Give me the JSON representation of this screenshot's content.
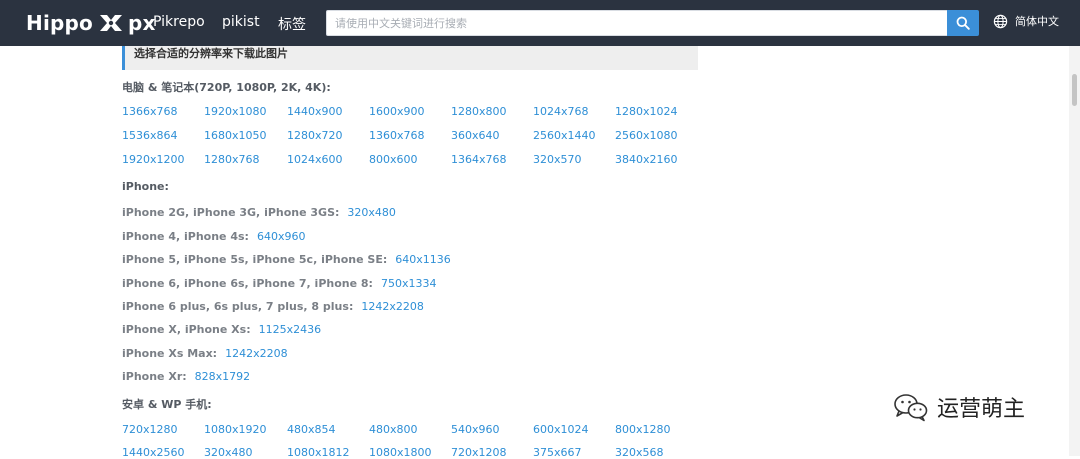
{
  "header": {
    "logo_left": "Hippo",
    "logo_right": "px",
    "nav": [
      "Pikrepo",
      "pikist",
      "标签"
    ],
    "search_placeholder": "请使用中文关键词进行搜索",
    "language": "简体中文"
  },
  "banner": "选择合适的分辨率来下载此图片",
  "computer": {
    "title": "电脑 & 笔记本(720P, 1080P, 2K, 4K):",
    "rows": [
      [
        "1366x768",
        "1920x1080",
        "1440x900",
        "1600x900",
        "1280x800",
        "1024x768",
        "1280x1024"
      ],
      [
        "1536x864",
        "1680x1050",
        "1280x720",
        "1360x768",
        "360x640",
        "2560x1440",
        "2560x1080"
      ],
      [
        "1920x1200",
        "1280x768",
        "1024x600",
        "800x600",
        "1364x768",
        "320x570",
        "3840x2160"
      ]
    ]
  },
  "iphone": {
    "title": "iPhone:",
    "items": [
      {
        "label": "iPhone 2G, iPhone 3G, iPhone 3GS:",
        "res": "320x480"
      },
      {
        "label": "iPhone 4, iPhone 4s:",
        "res": "640x960"
      },
      {
        "label": "iPhone 5, iPhone 5s, iPhone 5c, iPhone SE:",
        "res": "640x1136"
      },
      {
        "label": "iPhone 6, iPhone 6s, iPhone 7, iPhone 8:",
        "res": "750x1334"
      },
      {
        "label": "iPhone 6 plus, 6s plus, 7 plus, 8 plus:",
        "res": "1242x2208"
      },
      {
        "label": "iPhone X, iPhone Xs:",
        "res": "1125x2436"
      },
      {
        "label": "iPhone Xs Max:",
        "res": "1242x2208"
      },
      {
        "label": "iPhone Xr:",
        "res": "828x1792"
      }
    ]
  },
  "android": {
    "title": "安卓 & WP 手机:",
    "rows": [
      [
        "720x1280",
        "1080x1920",
        "480x854",
        "480x800",
        "540x960",
        "600x1024",
        "800x1280"
      ],
      [
        "1440x2560",
        "320x480",
        "1080x1812",
        "1080x1800",
        "720x1208",
        "375x667",
        "320x568"
      ]
    ]
  },
  "watermark": "运营萌主",
  "colors": {
    "header_bg": "#2b3340",
    "link": "#2e8fd6",
    "accent": "#3b8fd8"
  },
  "icons": {
    "search": "search-icon",
    "language": "globe-icon",
    "watermark": "wechat-icon"
  }
}
